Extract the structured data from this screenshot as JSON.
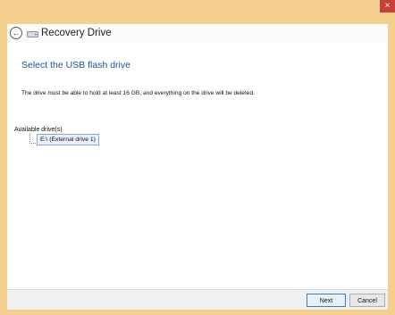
{
  "window": {
    "close_glyph": "×",
    "accent_color": "#F5CF8E"
  },
  "header": {
    "back_glyph": "←",
    "title": "Recovery Drive"
  },
  "content": {
    "heading": "Select the USB flash drive",
    "description": "The drive must be able to hold at least 16 GB, and everything on the drive will be deleted.",
    "available_label": "Available drive(s)",
    "drives": [
      {
        "label": "E:\\ (External drive 1)",
        "selected": true
      }
    ]
  },
  "footer": {
    "next_label": "Next",
    "cancel_label": "Cancel"
  },
  "icons": {
    "back": "back-arrow-icon",
    "drive": "drive-icon",
    "close": "close-icon"
  }
}
